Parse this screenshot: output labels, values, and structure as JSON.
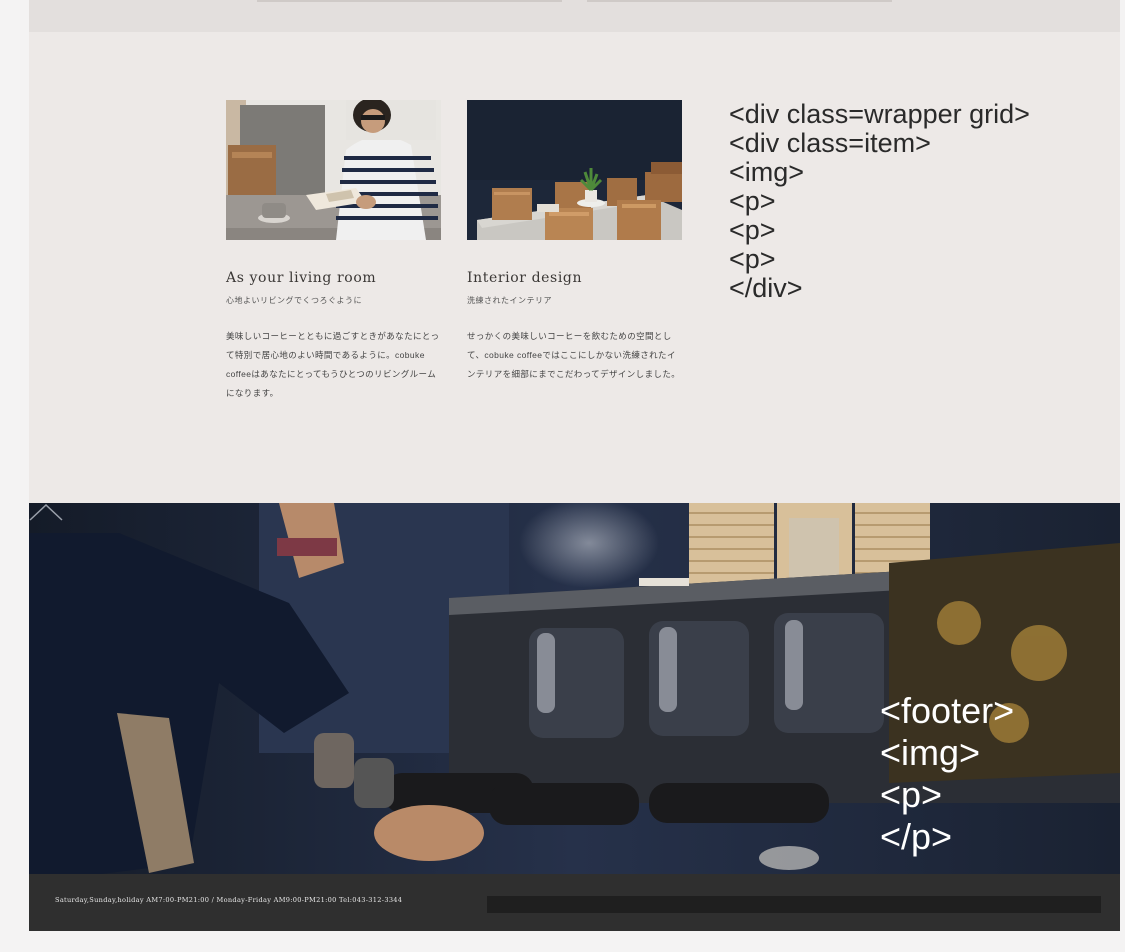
{
  "items": [
    {
      "title": "As your living room",
      "subtitle": "心地よいリビングでくつろぐように",
      "body": "美味しいコーヒーとともに過ごすときがあなたにとって特別で居心地のよい時間であるように。cobuke coffeeはあなたにとってもうひとつのリビングルームになります。",
      "image": "person-reading-at-cafe-table"
    },
    {
      "title": "Interior design",
      "subtitle": "洗練されたインテリア",
      "body": "せっかくの美味しいコーヒーを飲むための空間として、cobuke coffeeではここにしかない洗練されたインテリアを細部にまでこだわってデザインしました。",
      "image": "wooden-chairs-and-plant-on-table"
    }
  ],
  "annotation": {
    "lines": [
      "<div class=wrapper grid>",
      "<div class=item>",
      "<img>",
      "<p>",
      "<p>",
      "<p>",
      "</div>"
    ]
  },
  "footer": {
    "image": "barista-at-espresso-machine",
    "hours": "Saturday,Sunday,holiday AM7:00-PM21:00 / Monday-Friday AM9:00-PM21:00 Tel:043-312-3344",
    "annotation_lines": [
      "<footer>",
      "<img>",
      "<p>",
      "</p>"
    ],
    "pagetop_icon": "chevron-up-icon"
  }
}
